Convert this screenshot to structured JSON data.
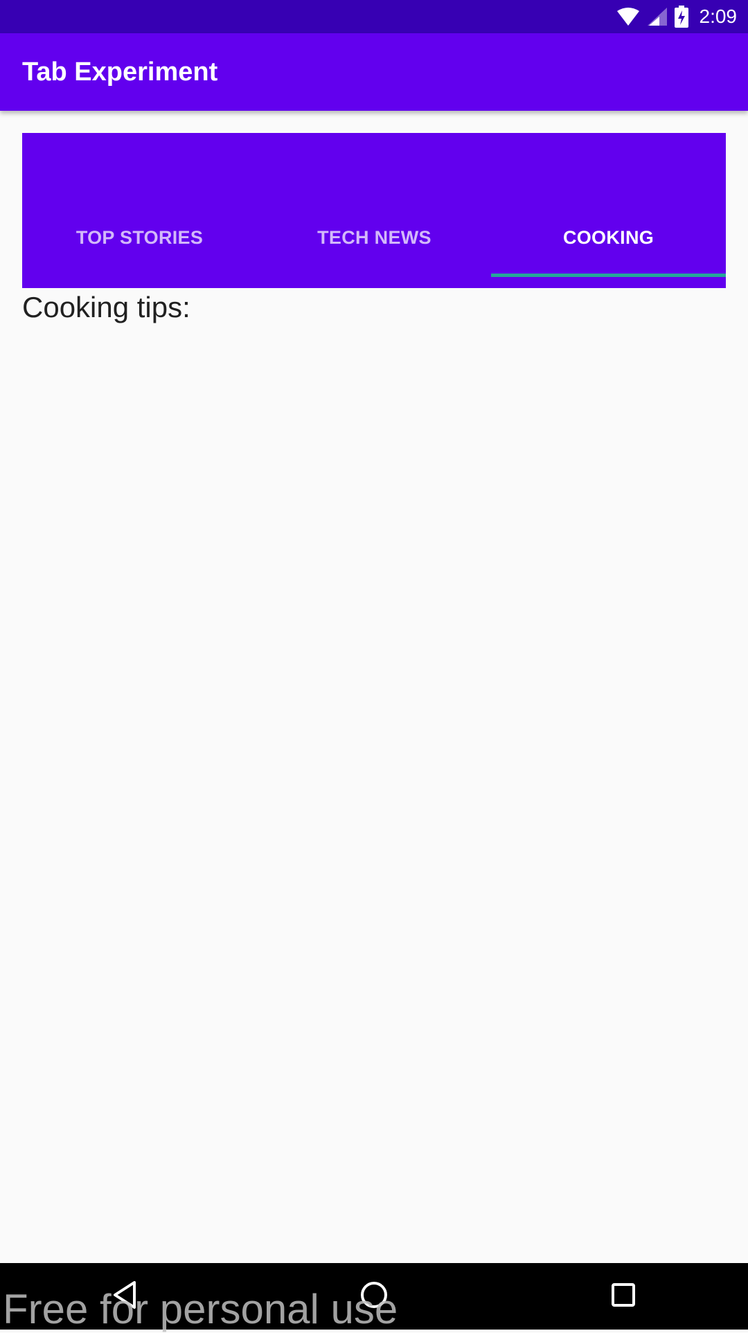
{
  "status_bar": {
    "time": "2:09",
    "icons": [
      "wifi-icon",
      "cell-signal-icon",
      "battery-charging-icon"
    ]
  },
  "app_bar": {
    "title": "Tab Experiment"
  },
  "tabs": [
    {
      "label": "TOP STORIES",
      "selected": false
    },
    {
      "label": "TECH NEWS",
      "selected": false
    },
    {
      "label": "COOKING",
      "selected": true
    }
  ],
  "content": {
    "text": "Cooking tips:"
  },
  "nav_bar": {
    "buttons": [
      "back-icon",
      "home-icon",
      "recents-icon"
    ]
  },
  "watermark": "Free for personal use",
  "colors": {
    "status_bar": "#3700B3",
    "primary": "#6200EE",
    "tab_indicator": "#26A69A",
    "background": "#FAFAFA"
  }
}
